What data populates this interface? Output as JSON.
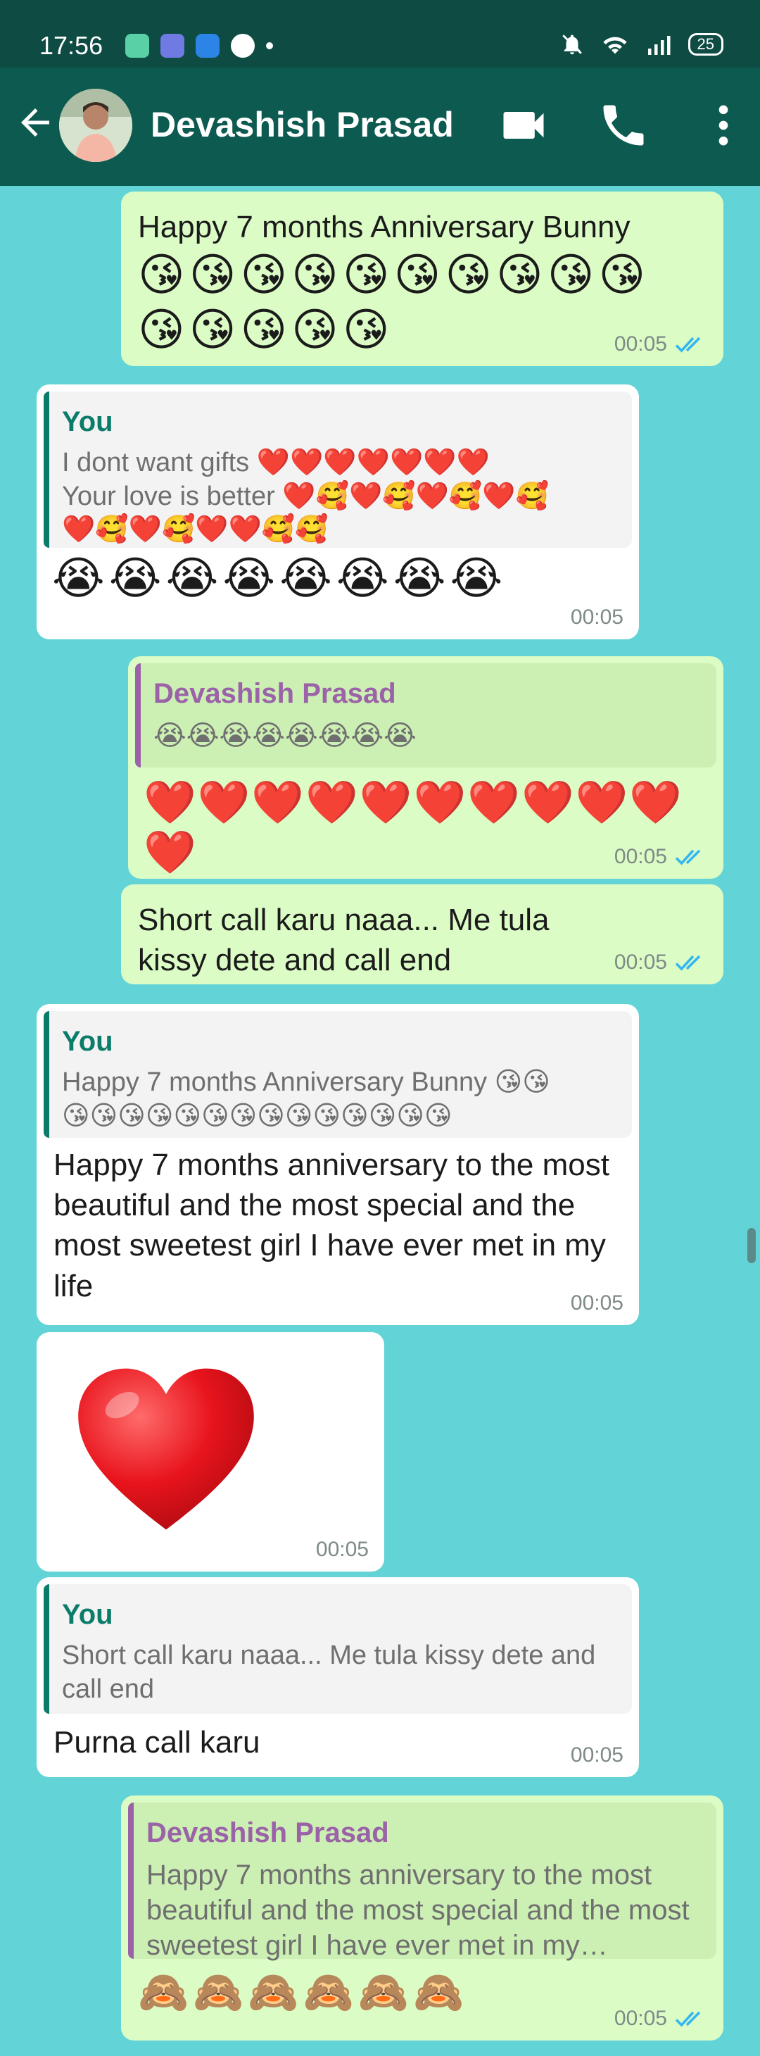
{
  "status": {
    "time": "17:56",
    "battery": "25"
  },
  "header": {
    "contact_name": "Devashish Prasad"
  },
  "messages": [
    {
      "dir": "out",
      "text": "Happy 7 months Anniversary Bunny",
      "emoji": "😘😘😘😘😘😘😘😘😘😘😘😘😘😘😘",
      "time": "00:05"
    },
    {
      "dir": "in",
      "quote_author": "You",
      "quote_line1": "I dont want gifts ❤️❤️❤️❤️❤️❤️❤️",
      "quote_line2": "Your love is better ❤️🥰❤️🥰❤️🥰❤️🥰",
      "quote_line3": "❤️🥰❤️🥰❤️❤️🥰🥰",
      "emoji": "😭😭😭😭😭😭😭😭",
      "time": "00:05"
    },
    {
      "dir": "out",
      "quote_author": "Devashish Prasad",
      "quote_line1": "😭😭😭😭😭😭😭😭",
      "emoji": "❤️❤️❤️❤️❤️❤️❤️❤️❤️❤️❤️",
      "time": "00:05"
    },
    {
      "dir": "out",
      "text": "Short call karu naaa... Me tula kissy dete and call end",
      "time": "00:05"
    },
    {
      "dir": "in",
      "quote_author": "You",
      "quote_line1": "Happy 7 months Anniversary Bunny 😘😘",
      "quote_line2": "😘😘😘😘😘😘😘😘😘😘😘😘😘😘",
      "text": "Happy 7 months anniversary to the most beautiful and the most special and the most sweetest girl I have ever met in my life",
      "time": "00:05"
    },
    {
      "dir": "in",
      "time": "00:05"
    },
    {
      "dir": "in",
      "quote_author": "You",
      "quote_line1": "Short call karu naaa... Me tula kissy dete and call end",
      "text": "Purna call karu",
      "time": "00:05"
    },
    {
      "dir": "out",
      "quote_author": "Devashish Prasad",
      "quote_line1": "Happy 7 months anniversary to the most beautiful and the most special and the most sweetest girl I have ever met in my…",
      "emoji": "🙈🙈🙈🙈🙈🙈",
      "time": "00:05"
    }
  ],
  "colors": {
    "header": "#0d5a50",
    "statusbar": "#0d4b43",
    "chat_bg": "#62d3d6",
    "outgoing": "#dcfcc6",
    "incoming": "#ffffff",
    "read_ticks": "#34b7f1"
  },
  "icons": [
    "back-arrow-icon",
    "video-call-icon",
    "phone-icon",
    "more-vert-icon",
    "double-check-icon",
    "mute-icon",
    "wifi-icon",
    "signal-icon"
  ]
}
